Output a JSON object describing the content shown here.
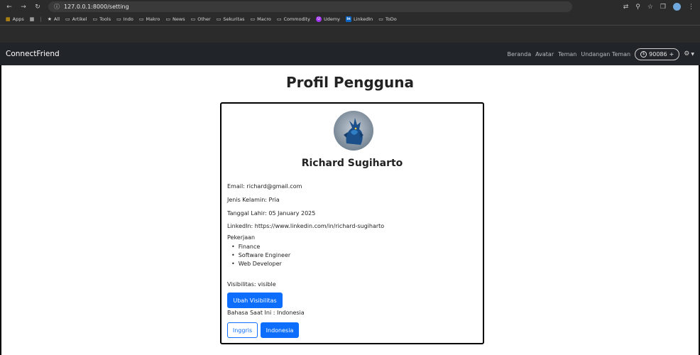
{
  "browser": {
    "url": "127.0.0.1:8000/setting",
    "bookmarks": [
      "Apps",
      "All",
      "Artikel",
      "Tools",
      "Indo",
      "Makro",
      "News",
      "Other",
      "Sekuritas",
      "Macro",
      "Commodity",
      "Udemy",
      "LinkedIn",
      "ToDo"
    ]
  },
  "navbar": {
    "brand": "ConnectFriend",
    "links": [
      "Beranda",
      "Avatar",
      "Teman",
      "Undangan Teman"
    ],
    "coins": "90086",
    "coins_add": "+"
  },
  "page": {
    "title": "Profil Pengguna"
  },
  "profile": {
    "name": "Richard Sugiharto",
    "email": "Email: richard@gmail.com",
    "gender": "Jenis Kelamin: Pria",
    "birthdate": "Tanggal Lahir: 05 January 2025",
    "linkedin": "LinkedIn: https://www.linkedin.com/in/richard-sugiharto",
    "jobs_label": "Pekerjaan",
    "jobs": [
      "Finance",
      "Software Engineer",
      "Web Developer"
    ],
    "visibility": "Visibilitas: visible",
    "visibility_button": "Ubah Visibilitas",
    "language": "Bahasa Saat Ini : Indonesia",
    "lang_buttons": [
      "Inggris",
      "Indonesia"
    ]
  },
  "colors": {
    "primary": "#0d6efd",
    "navbar": "#212529",
    "chrome": "#2b2b2b"
  }
}
